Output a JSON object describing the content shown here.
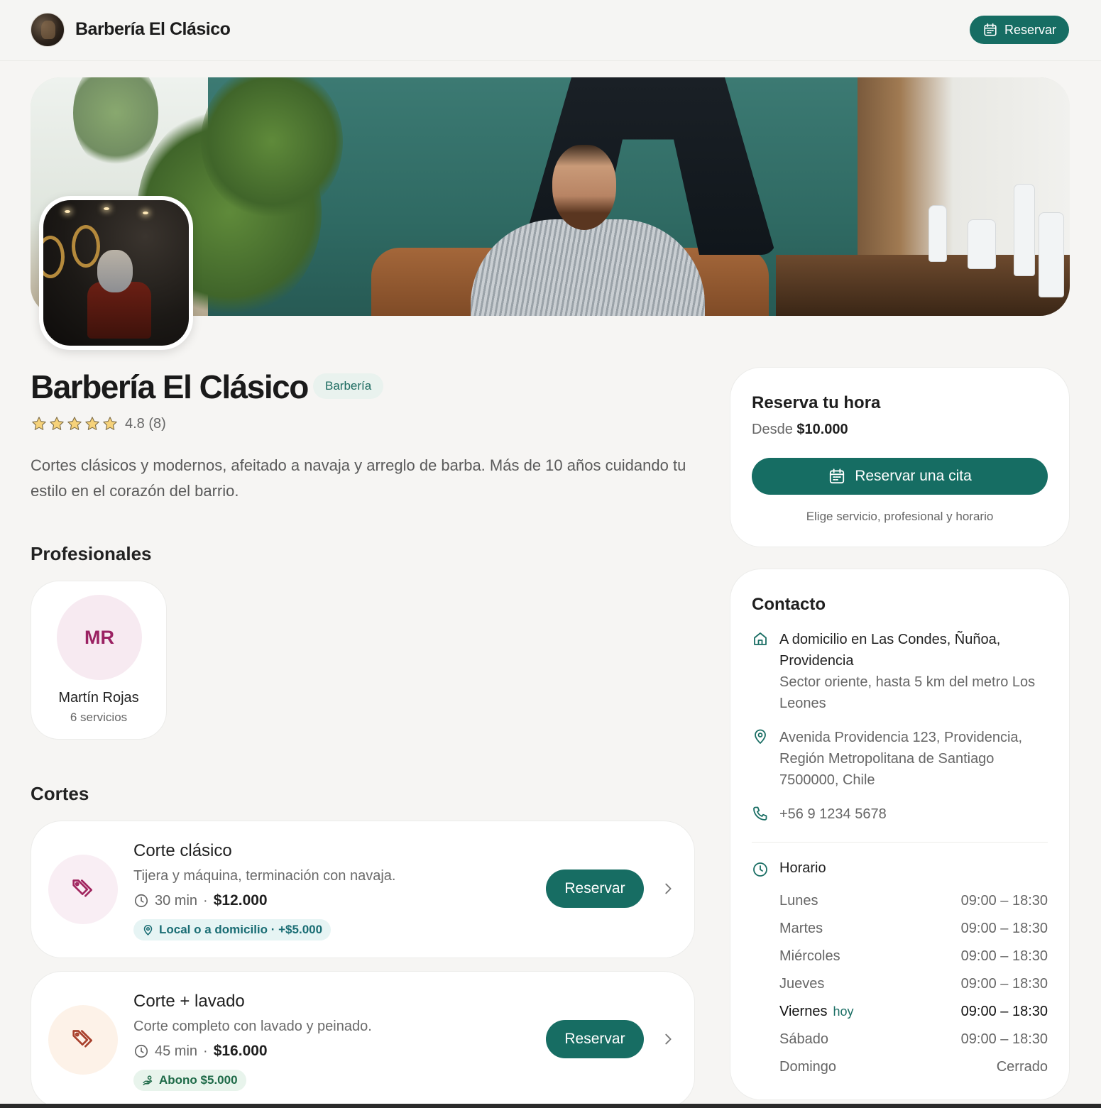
{
  "header": {
    "brand_name": "Barbería El Clásico",
    "reserve_label": "Reservar"
  },
  "business": {
    "name": "Barbería El Clásico",
    "category": "Barbería",
    "rating": "4.8 (8)",
    "description": "Cortes clásicos y modernos, afeitado a navaja y arreglo de barba. Más de 10 años cuidando tu estilo en el corazón del barrio."
  },
  "sections": {
    "professionals": "Profesionales",
    "cuts": "Cortes"
  },
  "professionals": [
    {
      "initials": "MR",
      "name": "Martín Rojas",
      "services": "6 servicios"
    }
  ],
  "services": [
    {
      "name": "Corte clásico",
      "description": "Tijera y máquina, terminación con navaja.",
      "duration": "30 min",
      "separator": "·",
      "price": "$12.000",
      "tag": "Local o a domicilio · +$5.000",
      "button": "Reservar"
    },
    {
      "name": "Corte + lavado",
      "description": "Corte completo con lavado y peinado.",
      "duration": "45 min",
      "separator": "·",
      "price": "$16.000",
      "tag": "Abono $5.000",
      "button": "Reservar"
    }
  ],
  "booking": {
    "title": "Reserva tu hora",
    "from_label": "Desde",
    "from_price": "$10.000",
    "button": "Reservar una cita",
    "hint": "Elige servicio, profesional y horario"
  },
  "contact": {
    "title": "Contacto",
    "home_service": "A domicilio en Las Condes, Ñuñoa, Providencia",
    "home_service_note": "Sector oriente, hasta 5 km del metro Los Leones",
    "address": "Avenida Providencia 123, Providencia, Región Metropolitana de Santiago 7500000, Chile",
    "phone": "+56 9 1234 5678",
    "hours_title": "Horario",
    "today_label": "hoy",
    "hours": [
      {
        "day": "Lunes",
        "time": "09:00 – 18:30"
      },
      {
        "day": "Martes",
        "time": "09:00 – 18:30"
      },
      {
        "day": "Miércoles",
        "time": "09:00 – 18:30"
      },
      {
        "day": "Jueves",
        "time": "09:00 – 18:30"
      },
      {
        "day": "Viernes",
        "time": "09:00 – 18:30"
      },
      {
        "day": "Sábado",
        "time": "09:00 – 18:30"
      },
      {
        "day": "Domingo",
        "time": "Cerrado"
      }
    ]
  },
  "colors": {
    "primary": "#166d63",
    "tag_teal_bg": "#e6f4f4",
    "tag_teal_text": "#1a6d74",
    "tag_green_bg": "#e8f4ec",
    "tag_green_text": "#1e6a48",
    "avatar_bg": "#f7eaf1",
    "avatar_text": "#9b2263"
  }
}
